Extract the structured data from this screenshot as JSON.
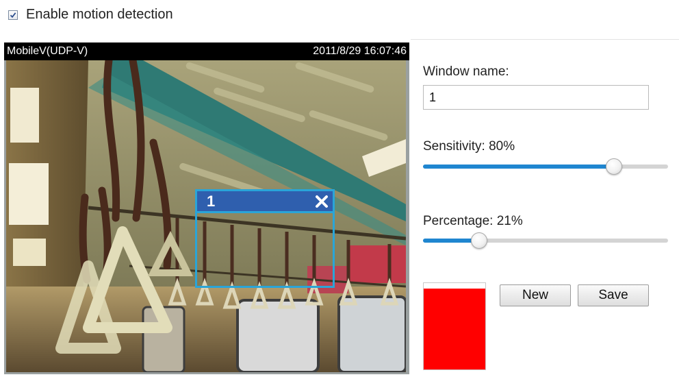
{
  "header": {
    "checkbox_checked": true,
    "label": "Enable motion detection"
  },
  "video": {
    "stream_name": "MobileV(UDP-V)",
    "timestamp": "2011/8/29 16:07:46",
    "motion_window": {
      "title": "1",
      "color": "#2aa5d8"
    }
  },
  "settings": {
    "window_name_label": "Window name:",
    "window_name_value": "1",
    "sensitivity_label": "Sensitivity: 80%",
    "sensitivity_value": 80,
    "percentage_label": "Percentage: 21%",
    "percentage_value": 21,
    "indicator_color": "#ff0000",
    "indicator_level": 94,
    "new_button": "New",
    "save_button": "Save"
  },
  "icons": {
    "checkbox": "checkmark-icon",
    "close": "close-icon"
  }
}
